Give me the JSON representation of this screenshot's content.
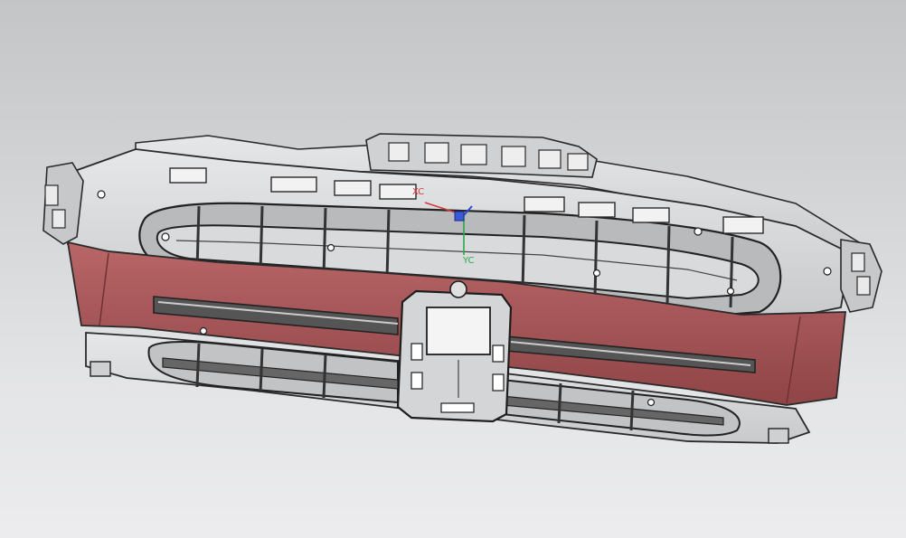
{
  "viewport": {
    "background_top": "#c4c5c7",
    "background_bottom": "#ececee"
  },
  "model": {
    "shell_color": "#d8d9db",
    "edge_color": "#2a2a2a",
    "accent_color": "#a85a5c",
    "accent_dark": "#7b3a3c"
  },
  "axes": {
    "x_label": "XC",
    "y_label": "YC",
    "x_color": "#d43a3a",
    "y_color": "#2aa84a",
    "z_color": "#2a4ad4"
  }
}
